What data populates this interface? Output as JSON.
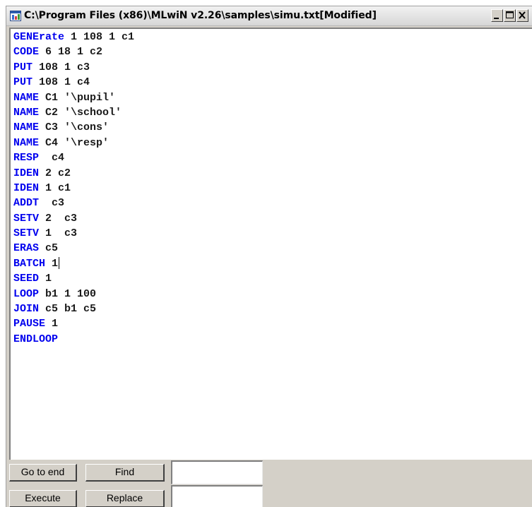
{
  "window": {
    "title": "C:\\Program Files (x86)\\MLwiN v2.26\\samples\\simu.txt[Modified]",
    "app_icon": "mlwin-doc-icon",
    "controls": {
      "minimize": "minimize-icon",
      "maximize": "maximize-icon",
      "close": "close-icon"
    }
  },
  "editor": {
    "lines": [
      {
        "keyword": "GENErate",
        "args": " 1 108 1 c1"
      },
      {
        "keyword": "CODE",
        "args": " 6 18 1 c2"
      },
      {
        "keyword": "PUT",
        "args": " 108 1 c3"
      },
      {
        "keyword": "PUT",
        "args": " 108 1 c4"
      },
      {
        "keyword": "NAME",
        "args": " C1 '\\pupil'"
      },
      {
        "keyword": "NAME",
        "args": " C2 '\\school'"
      },
      {
        "keyword": "NAME",
        "args": " C3 '\\cons'"
      },
      {
        "keyword": "NAME",
        "args": " C4 '\\resp'"
      },
      {
        "keyword": "RESP",
        "args": "  c4"
      },
      {
        "keyword": "IDEN",
        "args": " 2 c2"
      },
      {
        "keyword": "IDEN",
        "args": " 1 c1"
      },
      {
        "keyword": "ADDT",
        "args": "  c3"
      },
      {
        "keyword": "SETV",
        "args": " 2  c3"
      },
      {
        "keyword": "SETV",
        "args": " 1  c3"
      },
      {
        "keyword": "ERAS",
        "args": " c5"
      },
      {
        "keyword": "BATCH",
        "args": " 1"
      },
      {
        "keyword": "SEED",
        "args": " 1"
      },
      {
        "keyword": "LOOP",
        "args": " b1 1 100"
      },
      {
        "keyword": "JOIN",
        "args": " c5 b1 c5"
      },
      {
        "keyword": "PAUSE",
        "args": " 1"
      },
      {
        "keyword": "ENDLOOP",
        "args": ""
      }
    ],
    "caret_line": 15
  },
  "controls": {
    "go_to_end_label": "Go to end",
    "find_label": "Find",
    "execute_label": "Execute",
    "replace_label": "Replace",
    "find_value": "",
    "replace_value": ""
  },
  "colors": {
    "keyword": "#0000ee",
    "text": "#1a1a1a",
    "panel": "#d4d0c8"
  }
}
